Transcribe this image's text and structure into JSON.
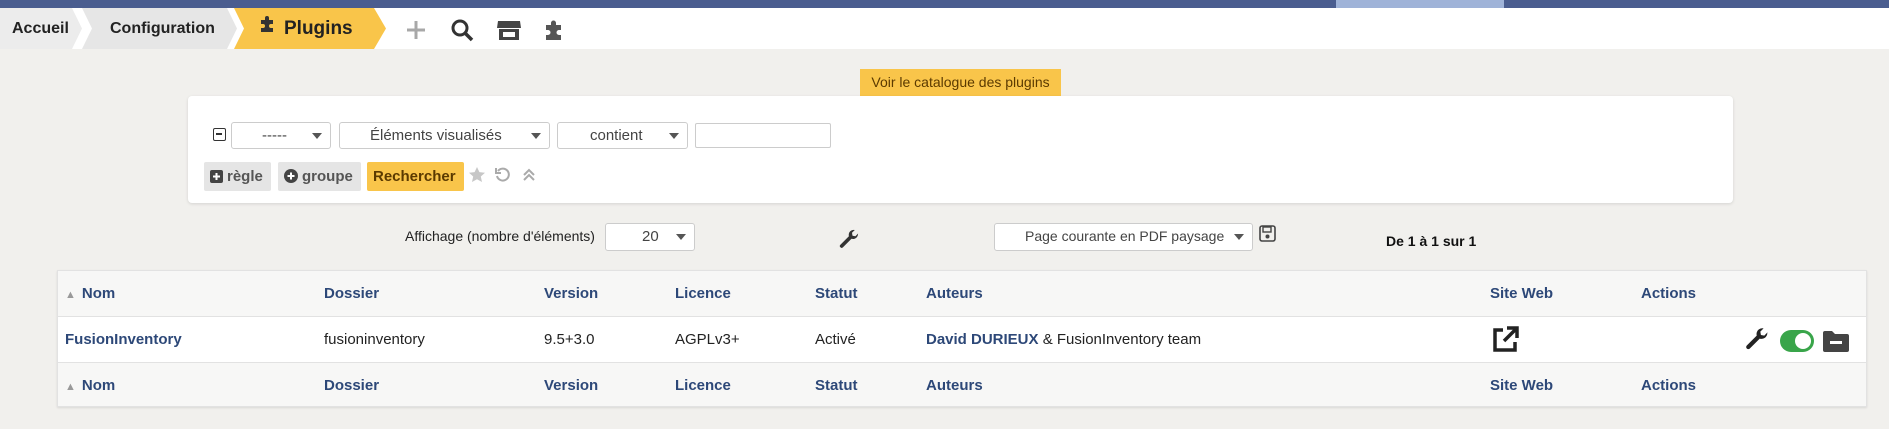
{
  "breadcrumb": {
    "home": "Accueil",
    "config": "Configuration",
    "current": "Plugins"
  },
  "nav_icons": [
    "plus-icon",
    "search-icon",
    "store-icon",
    "puzzle-icon"
  ],
  "catalog_button": "Voir le catalogue des plugins",
  "search": {
    "field_select": "-----",
    "criteria_select": "Éléments visualisés",
    "operator_select": "contient",
    "value_input": "",
    "rule_button": "règle",
    "group_button": "groupe",
    "search_button": "Rechercher"
  },
  "display": {
    "label": "Affichage (nombre d'éléments)",
    "count": "20",
    "export_select": "Page courante en PDF paysage",
    "pager": "De 1 à 1 sur 1"
  },
  "table": {
    "columns": [
      "Nom",
      "Dossier",
      "Version",
      "Licence",
      "Statut",
      "Auteurs",
      "Site Web",
      "Actions"
    ],
    "rows": [
      {
        "name": "FusionInventory",
        "folder": "fusioninventory",
        "version": "9.5+3.0",
        "license": "AGPLv3+",
        "status": "Activé",
        "author_main": "David DURIEUX",
        "author_rest": " & FusionInventory team"
      }
    ]
  },
  "colors": {
    "accent": "#f9c54a",
    "link": "#2d4878",
    "topbar": "#4a5d8f",
    "toggle_on": "#39a54a"
  }
}
